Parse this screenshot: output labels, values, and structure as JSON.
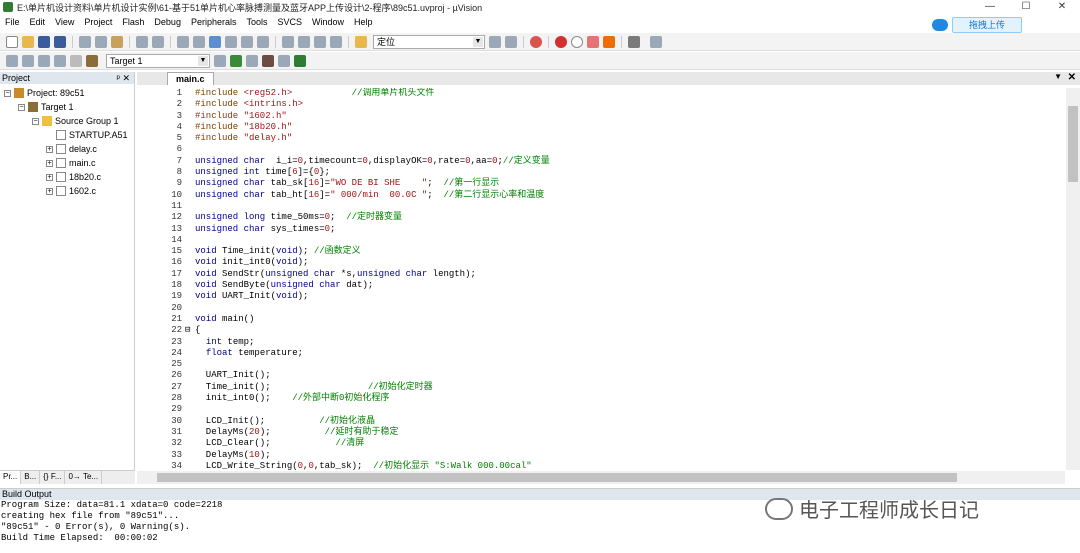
{
  "window": {
    "title": "E:\\单片机设计资料\\单片机设计实例\\61-基于51单片机心率脉搏测量及蓝牙APP上传设计\\2-程序\\89c51.uvproj - µVision",
    "min": "—",
    "max": "☐",
    "close": "✕"
  },
  "menu": [
    "File",
    "Edit",
    "View",
    "Project",
    "Flash",
    "Debug",
    "Peripherals",
    "Tools",
    "SVCS",
    "Window",
    "Help"
  ],
  "upload": {
    "label": "拖拽上传"
  },
  "toolbar": {
    "find_value": "定位",
    "target": "Target 1"
  },
  "project": {
    "title": "Project",
    "pin": "ᵖ ✕",
    "tree": [
      {
        "label": "Project: 89c51",
        "level": 0,
        "icon": "project-icon",
        "exp": "−"
      },
      {
        "label": "Target 1",
        "level": 1,
        "icon": "target-icon",
        "exp": "−"
      },
      {
        "label": "Source Group 1",
        "level": 2,
        "icon": "folder-icon",
        "exp": "−"
      },
      {
        "label": "STARTUP.A51",
        "level": 3,
        "icon": "file-icon",
        "exp": ""
      },
      {
        "label": "delay.c",
        "level": 3,
        "icon": "file-icon",
        "exp": "+"
      },
      {
        "label": "main.c",
        "level": 3,
        "icon": "file-icon",
        "exp": "+"
      },
      {
        "label": "18b20.c",
        "level": 3,
        "icon": "file-icon",
        "exp": "+"
      },
      {
        "label": "1602.c",
        "level": 3,
        "icon": "file-icon",
        "exp": "+"
      }
    ],
    "tabs": [
      "Pr...",
      "B...",
      "{} F...",
      "0→ Te..."
    ]
  },
  "editor": {
    "tab": "main.c",
    "lines": [
      [
        [
          "pp",
          "#include "
        ],
        [
          "st",
          "<reg52.h>"
        ],
        [
          "cm",
          "           //调用单片机头文件"
        ]
      ],
      [
        [
          "pp",
          "#include "
        ],
        [
          "st",
          "<intrins.h>"
        ]
      ],
      [
        [
          "pp",
          "#include "
        ],
        [
          "st",
          "\"1602.h\""
        ]
      ],
      [
        [
          "pp",
          "#include "
        ],
        [
          "st",
          "\"18b20.h\""
        ]
      ],
      [
        [
          "pp",
          "#include "
        ],
        [
          "st",
          "\"delay.h\""
        ]
      ],
      [],
      [
        [
          "kw",
          "unsigned char"
        ],
        [
          "",
          "  i_i="
        ],
        [
          "num",
          "0"
        ],
        [
          "",
          ",timecount="
        ],
        [
          "num",
          "0"
        ],
        [
          "",
          ",displayOK="
        ],
        [
          "num",
          "0"
        ],
        [
          "",
          ",rate="
        ],
        [
          "num",
          "0"
        ],
        [
          "",
          ",aa="
        ],
        [
          "num",
          "0"
        ],
        [
          "",
          ";"
        ],
        [
          "cm",
          "//定义变量"
        ]
      ],
      [
        [
          "kw",
          "unsigned int"
        ],
        [
          "",
          " time["
        ],
        [
          "num",
          "6"
        ],
        [
          "",
          "]={"
        ],
        [
          "num",
          "0"
        ],
        [
          "",
          "};"
        ]
      ],
      [
        [
          "kw",
          "unsigned char"
        ],
        [
          "",
          " tab_sk["
        ],
        [
          "num",
          "16"
        ],
        [
          "",
          "]="
        ],
        [
          "st",
          "\"WO DE BI SHE    \""
        ],
        [
          "",
          ";  "
        ],
        [
          "cm",
          "//第一行显示"
        ]
      ],
      [
        [
          "kw",
          "unsigned char"
        ],
        [
          "",
          " tab_ht["
        ],
        [
          "num",
          "16"
        ],
        [
          "",
          "]="
        ],
        [
          "st",
          "\" 000/min  00.0C \""
        ],
        [
          "",
          ";  "
        ],
        [
          "cm",
          "//第二行显示心率和温度"
        ]
      ],
      [],
      [
        [
          "kw",
          "unsigned long"
        ],
        [
          "",
          " time_50ms="
        ],
        [
          "num",
          "0"
        ],
        [
          "",
          ";  "
        ],
        [
          "cm",
          "//定时器变量"
        ]
      ],
      [
        [
          "kw",
          "unsigned char"
        ],
        [
          "",
          " sys_times="
        ],
        [
          "num",
          "0"
        ],
        [
          "",
          ";"
        ]
      ],
      [],
      [
        [
          "kw",
          "void"
        ],
        [
          "",
          " Time_init("
        ],
        [
          "kw",
          "void"
        ],
        [
          "",
          "); "
        ],
        [
          "cm",
          "//函数定义"
        ]
      ],
      [
        [
          "kw",
          "void"
        ],
        [
          "",
          " init_int0("
        ],
        [
          "kw",
          "void"
        ],
        [
          "",
          ");"
        ]
      ],
      [
        [
          "kw",
          "void"
        ],
        [
          "",
          " SendStr("
        ],
        [
          "kw",
          "unsigned char"
        ],
        [
          "",
          " *s,"
        ],
        [
          "kw",
          "unsigned char"
        ],
        [
          "",
          " length);"
        ]
      ],
      [
        [
          "kw",
          "void"
        ],
        [
          "",
          " SendByte("
        ],
        [
          "kw",
          "unsigned char"
        ],
        [
          "",
          " dat);"
        ]
      ],
      [
        [
          "kw",
          "void"
        ],
        [
          "",
          " UART_Init("
        ],
        [
          "kw",
          "void"
        ],
        [
          "",
          ");"
        ]
      ],
      [],
      [
        [
          "kw",
          "void"
        ],
        [
          "",
          " main()"
        ]
      ],
      [
        [
          "",
          "{"
        ]
      ],
      [
        [
          "",
          "  "
        ],
        [
          "kw",
          "int"
        ],
        [
          "",
          " temp;"
        ]
      ],
      [
        [
          "",
          "  "
        ],
        [
          "kw",
          "float"
        ],
        [
          "",
          " temperature;"
        ]
      ],
      [],
      [
        [
          "",
          "  UART_Init();"
        ]
      ],
      [
        [
          "",
          "  Time_init();                  "
        ],
        [
          "cm",
          "//初始化定时器"
        ]
      ],
      [
        [
          "",
          "  init_int0();    "
        ],
        [
          "cm",
          "//外部中断0初始化程序"
        ]
      ],
      [],
      [
        [
          "",
          "  LCD_Init();          "
        ],
        [
          "cm",
          "//初始化液晶"
        ]
      ],
      [
        [
          "",
          "  DelayMs("
        ],
        [
          "num",
          "20"
        ],
        [
          "",
          ");          "
        ],
        [
          "cm",
          "//延时有助于稳定"
        ]
      ],
      [
        [
          "",
          "  LCD_Clear();            "
        ],
        [
          "cm",
          "//清屏"
        ]
      ],
      [
        [
          "",
          "  DelayMs("
        ],
        [
          "num",
          "10"
        ],
        [
          "",
          ");"
        ]
      ],
      [
        [
          "",
          "  LCD_Write_String("
        ],
        [
          "num",
          "0"
        ],
        [
          "",
          ","
        ],
        [
          "num",
          "0"
        ],
        [
          "",
          ",tab_sk);  "
        ],
        [
          "cm",
          "//初始化显示 \"S:Walk 000.00cal\""
        ]
      ]
    ]
  },
  "build": {
    "title": "Build Output",
    "lines": [
      "Program Size: data=81.1 xdata=0 code=2218",
      "creating hex file from \"89c51\"...",
      "\"89c51\" - 0 Error(s), 0 Warning(s).",
      "Build Time Elapsed:  00:00:02"
    ]
  },
  "watermark": "电子工程师成长日记",
  "colors": {
    "keyword": "#00008b",
    "comment": "#008000",
    "string": "#a31515",
    "preproc": "#7f3f00"
  }
}
